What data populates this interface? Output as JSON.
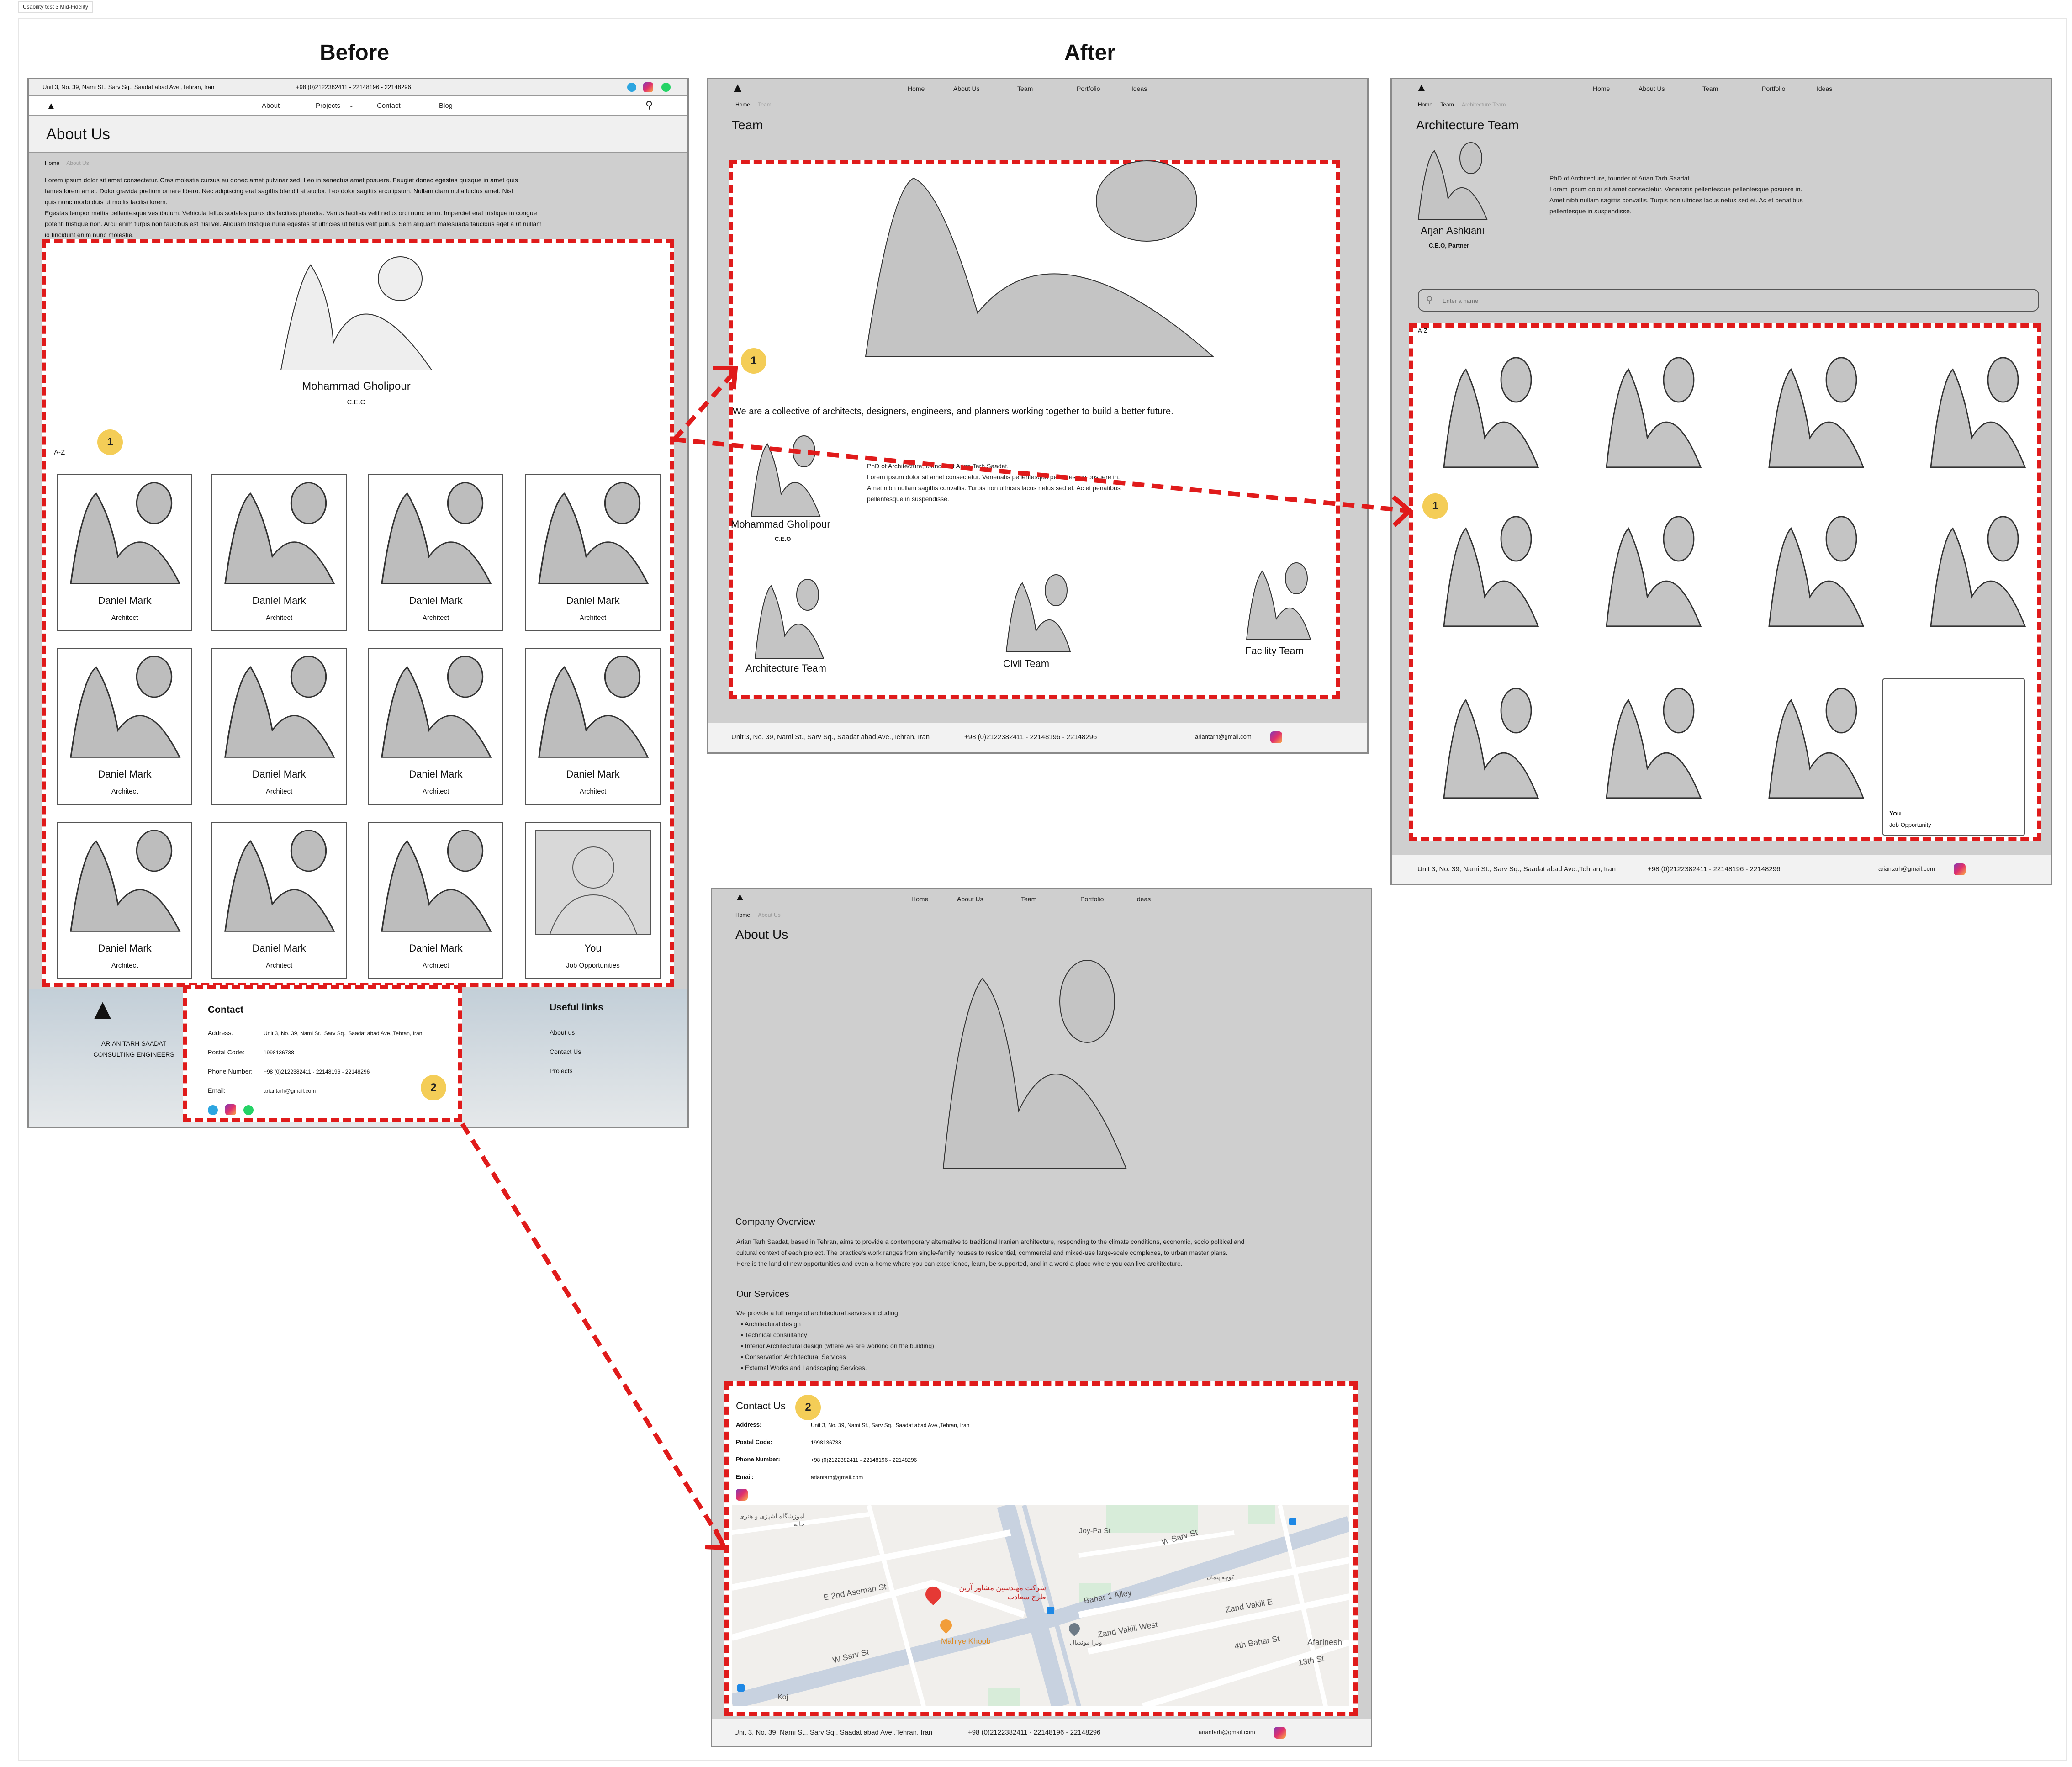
{
  "caption": "Usability test 3 Mid-Fidelity",
  "headings": {
    "before": "Before",
    "after": "After"
  },
  "before": {
    "topbar": {
      "address": "Unit 3, No. 39, Nami St., Sarv Sq., Saadat abad Ave.,Tehran, Iran",
      "phone": "+98 (0)2122382411 - 22148196 - 22148296"
    },
    "nav": [
      "About",
      "Projects",
      "Contact",
      "Blog"
    ],
    "page_title": "About Us",
    "breadcrumb": {
      "home": "Home",
      "current": "About Us"
    },
    "intro": [
      "Lorem ipsum dolor sit amet consectetur. Cras molestie cursus eu donec amet pulvinar sed. Leo in senectus amet posuere. Feugiat donec egestas quisque in amet quis",
      "fames lorem amet. Dolor gravida pretium ornare libero. Nec adipiscing erat sagittis blandit at auctor. Leo dolor sagittis arcu ipsum. Nullam diam nulla luctus amet. Nisl",
      "quis nunc morbi duis ut mollis facilisi lorem.",
      "Egestas tempor mattis pellentesque vestibulum. Vehicula tellus sodales purus dis facilisis pharetra. Varius facilisis velit netus orci nunc enim. Imperdiet erat tristique in congue",
      " potenti tristique non. Arcu enim turpis non faucibus est nisl vel. Aliquam tristique nulla egestas at ultricies ut tellus velit purus. Sem aliquam malesuada faucibus eget a ut nullam",
      "id tincidunt enim nunc molestie."
    ],
    "ceo": {
      "name": "Mohammad Gholipour",
      "role": "C.E.O"
    },
    "sort_label": "A-Z",
    "badge1": "1",
    "members": [
      {
        "name": "Daniel Mark",
        "role": "Architect"
      },
      {
        "name": "Daniel Mark",
        "role": "Architect"
      },
      {
        "name": "Daniel Mark",
        "role": "Architect"
      },
      {
        "name": "Daniel Mark",
        "role": "Architect"
      },
      {
        "name": "Daniel Mark",
        "role": "Architect"
      },
      {
        "name": "Daniel Mark",
        "role": "Architect"
      },
      {
        "name": "Daniel Mark",
        "role": "Architect"
      },
      {
        "name": "Daniel Mark",
        "role": "Architect"
      },
      {
        "name": "Daniel Mark",
        "role": "Architect"
      },
      {
        "name": "Daniel Mark",
        "role": "Architect"
      },
      {
        "name": "Daniel Mark",
        "role": "Architect"
      }
    ],
    "you_card": {
      "name": "You",
      "role": "Job Opportunities"
    },
    "footer": {
      "company_line1": "ARIAN TARH SAADAT",
      "company_line2": "CONSULTING ENGINEERS",
      "contact_title": "Contact",
      "address_label": "Address:",
      "address_value": "Unit 3, No. 39, Nami St., Sarv Sq., Saadat abad Ave.,Tehran, Iran",
      "postal_label": "Postal Code:",
      "postal_value": "1998136738",
      "phone_label": "Phone Number:",
      "phone_value": "+98 (0)2122382411 - 22148196 - 22148296",
      "email_label": "Email:",
      "email_value": "ariantarh@gmail.com",
      "badge2": "2",
      "links_title": "Useful links",
      "links": [
        "About us",
        "Contact Us",
        "Projects"
      ]
    }
  },
  "after_team": {
    "nav": [
      "Home",
      "About Us",
      "Team",
      "Portfolio",
      "Ideas"
    ],
    "breadcrumb": {
      "home": "Home",
      "current": "Team"
    },
    "page_title": "Team",
    "badge1": "1",
    "tagline": "We are a collective of architects, designers, engineers, and planners working together to build a better future.",
    "founder": {
      "name": "Mohammad Gholipour",
      "role": "C.E.O",
      "bio": [
        "PhD of Architecture, founder of Arian Tarh Saadat.",
        "Lorem ipsum dolor sit amet consectetur. Venenatis pellentesque pellentesque posuere in.",
        "Amet nibh nullam sagittis convallis. Turpis non ultrices lacus netus sed et. Ac et penatibus",
        " pellentesque in suspendisse."
      ]
    },
    "teams": [
      "Architecture Team",
      "Civil Team",
      "Facility Team"
    ],
    "footer": {
      "address": "Unit 3, No. 39, Nami St., Sarv Sq., Saadat abad Ave.,Tehran, Iran",
      "phone": "+98 (0)2122382411 - 22148196 - 22148296",
      "email": "ariantarh@gmail.com"
    }
  },
  "after_arch": {
    "nav": [
      "Home",
      "About Us",
      "Team",
      "Portfolio",
      "Ideas"
    ],
    "breadcrumb": {
      "home": "Home",
      "mid": "Team",
      "current": "Architecture Team"
    },
    "page_title": "Architecture Team",
    "lead": {
      "name": "Arjan Ashkiani",
      "role": "C.E.O, Partner",
      "bio": [
        "PhD of Architecture, founder of Arian Tarh Saadat.",
        "Lorem ipsum dolor sit amet consectetur. Venenatis pellentesque pellentesque posuere in.",
        "Amet nibh nullam sagittis convallis. Turpis non ultrices lacus netus sed et. Ac et penatibus",
        " pellentesque in suspendisse."
      ]
    },
    "search_placeholder": "Enter a name",
    "sort_label": "A-Z",
    "badge1": "1",
    "you_card": {
      "name": "You",
      "role": "Job Opportunity"
    },
    "footer": {
      "address": "Unit 3, No. 39, Nami St., Sarv Sq., Saadat abad Ave.,Tehran, Iran",
      "phone": "+98 (0)2122382411 - 22148196 - 22148296",
      "email": "ariantarh@gmail.com"
    }
  },
  "after_about": {
    "nav": [
      "Home",
      "About Us",
      "Team",
      "Portfolio",
      "Ideas"
    ],
    "breadcrumb": {
      "home": "Home",
      "current": "About Us"
    },
    "page_title": "About Us",
    "overview_title": "Company Overview",
    "overview": [
      "Arian Tarh Saadat, based in Tehran, aims to provide a contemporary alternative to traditional Iranian architecture, responding to the climate conditions, economic, socio political and",
      "cultural context of each project. The practice's work ranges from single-family houses to residential, commercial and mixed-use large-scale complexes, to urban master plans.",
      "Here is the land of new opportunities and even a home where you can experience, learn, be supported, and in a word a place where you can live architecture."
    ],
    "services_title": "Our Services",
    "services_intro": "We provide a full range of architectural services including:",
    "services": [
      "Architectural design",
      "Technical consultancy",
      "Interior Architectural design (where we are working on the building)",
      "Conservation Architectural Services",
      "External Works and Landscaping Services."
    ],
    "contact_title": "Contact Us",
    "badge2": "2",
    "address_label": "Address:",
    "address_value": "Unit 3, No. 39, Nami St., Sarv Sq., Saadat abad Ave.,Tehran, Iran",
    "postal_label": "Postal Code:",
    "postal_value": "1998136738",
    "phone_label": "Phone Number:",
    "phone_value": "+98 (0)2122382411 - 22148196 - 22148296",
    "email_label": "Email:",
    "email_value": "ariantarh@gmail.com",
    "map": {
      "streets": [
        "Joy-Pa St",
        "W Sarv St",
        "E 2nd Aseman St",
        "Bahar 1 Alley",
        "Zand Vakili West",
        "Zand Vakili E",
        "4th Bahar St",
        "13th St",
        "W Sarv St",
        "Afarinesh",
        "Koj"
      ],
      "poi_main": "شرکت مهندسین مشاور آرین طرح سعادت",
      "poi_food": "Mahiye Khoob",
      "poi_school": "اموزشگاه آشپزی و هنری خانه",
      "poi_other": "ویرا مونديال",
      "poi_street": "کوچه پیمان"
    },
    "footer": {
      "address": "Unit 3, No. 39, Nami St., Sarv Sq., Saadat abad Ave.,Tehran, Iran",
      "phone": "+98 (0)2122382411 - 22148196 - 22148296",
      "email": "ariantarh@gmail.com"
    }
  },
  "colors": {
    "red": "#e01b1b",
    "badge": "#f4cd57",
    "frame": "#cfcfcf",
    "placeholder": "#bdbdbd"
  }
}
